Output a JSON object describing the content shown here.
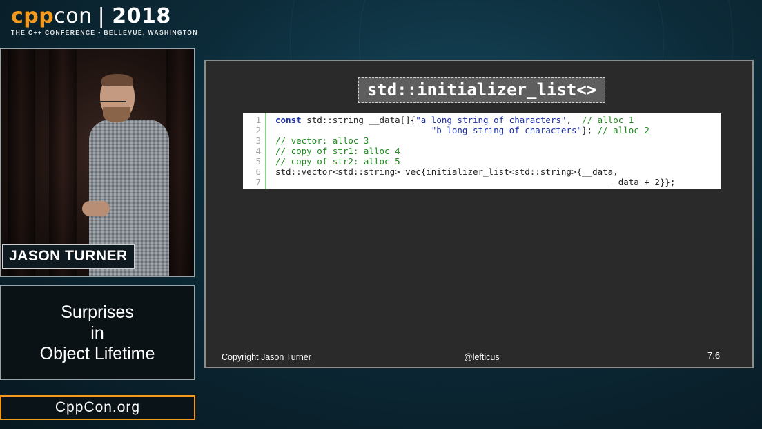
{
  "logo": {
    "part1": "cpp",
    "part2": "con",
    "year": "2018",
    "tagline": "THE C++ CONFERENCE • BELLEVUE, WASHINGTON"
  },
  "speaker": {
    "name": "JASON TURNER"
  },
  "talk": {
    "title_lines": [
      "Surprises",
      "in",
      "Object Lifetime"
    ]
  },
  "site": "CppCon.org",
  "slide": {
    "title": "std::initializer_list<>",
    "code_lines": [
      {
        "num": "1",
        "parts": [
          {
            "t": "const",
            "c": "kw"
          },
          {
            "t": " std::string __data[]{",
            "c": "plain"
          },
          {
            "t": "\"a long string of characters\"",
            "c": "str"
          },
          {
            "t": ",  ",
            "c": "plain"
          },
          {
            "t": "// alloc 1",
            "c": "cm"
          }
        ]
      },
      {
        "num": "2",
        "parts": [
          {
            "t": "                              ",
            "c": "plain"
          },
          {
            "t": "\"b long string of characters\"",
            "c": "str"
          },
          {
            "t": "}; ",
            "c": "plain"
          },
          {
            "t": "// alloc 2",
            "c": "cm"
          }
        ]
      },
      {
        "num": "3",
        "parts": [
          {
            "t": "// vector: alloc 3",
            "c": "cm"
          }
        ]
      },
      {
        "num": "4",
        "parts": [
          {
            "t": "// copy of str1: alloc 4",
            "c": "cm"
          }
        ]
      },
      {
        "num": "5",
        "parts": [
          {
            "t": "// copy of str2: alloc 5",
            "c": "cm"
          }
        ]
      },
      {
        "num": "6",
        "parts": [
          {
            "t": "std::vector<std::string> vec{initializer_list<std::string>{__data,",
            "c": "plain"
          }
        ]
      },
      {
        "num": "7",
        "parts": [
          {
            "t": "                                                                __data + 2}};",
            "c": "plain"
          }
        ]
      }
    ],
    "footer_left": "Copyright Jason Turner",
    "footer_mid": "@lefticus",
    "slide_number": "7.6"
  }
}
